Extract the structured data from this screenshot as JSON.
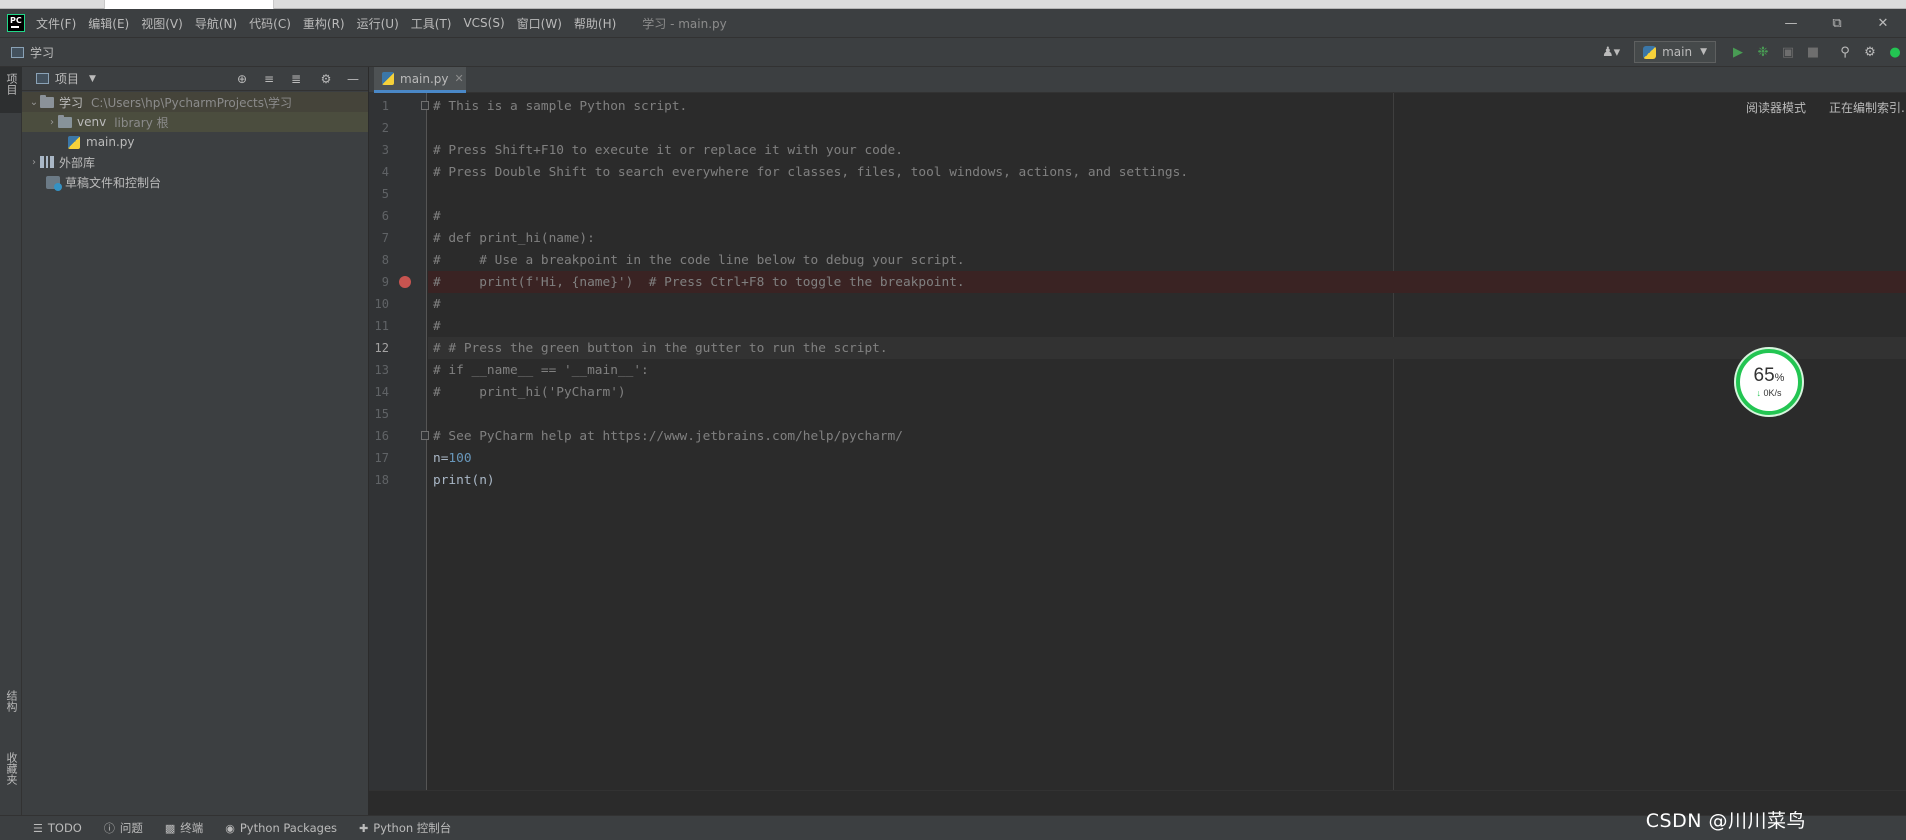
{
  "menubar": {
    "items": [
      "文件(F)",
      "编辑(E)",
      "视图(V)",
      "导航(N)",
      "代码(C)",
      "重构(R)",
      "运行(U)",
      "工具(T)",
      "VCS(S)",
      "窗口(W)",
      "帮助(H)"
    ],
    "window_title": "学习 - main.py",
    "logo_text": "PC"
  },
  "navbar": {
    "breadcrumb": "学习",
    "run_config": "main"
  },
  "left_strip": {
    "project_tab": "项目",
    "structure_tab": "结构",
    "favorites_tab": "收藏夹"
  },
  "project_panel": {
    "title": "项目",
    "tree": [
      {
        "label": "学习",
        "sub": "C:\\Users\\hp\\PycharmProjects\\学习"
      },
      {
        "label": "venv",
        "sub": "library 根"
      },
      {
        "label": "main.py",
        "sub": ""
      },
      {
        "label": "外部库",
        "sub": ""
      },
      {
        "label": "草稿文件和控制台",
        "sub": ""
      }
    ]
  },
  "editor": {
    "tab_label": "main.py",
    "reader_mode": "阅读器模式",
    "indexing": "正在编制索引...",
    "current_line": 12,
    "breakpoint_line": 9,
    "lines": [
      {
        "n": "1",
        "t": "# This is a sample Python script."
      },
      {
        "n": "2",
        "t": ""
      },
      {
        "n": "3",
        "t": "# Press Shift+F10 to execute it or replace it with your code."
      },
      {
        "n": "4",
        "t": "# Press Double Shift to search everywhere for classes, files, tool windows, actions, and settings."
      },
      {
        "n": "5",
        "t": ""
      },
      {
        "n": "6",
        "t": "#"
      },
      {
        "n": "7",
        "t": "# def print_hi(name):"
      },
      {
        "n": "8",
        "t": "#     # Use a breakpoint in the code line below to debug your script."
      },
      {
        "n": "9",
        "t": "#     print(f'Hi, {name}')  # Press Ctrl+F8 to toggle the breakpoint."
      },
      {
        "n": "10",
        "t": "#"
      },
      {
        "n": "11",
        "t": "#"
      },
      {
        "n": "12",
        "t": "# # Press the green button in the gutter to run the script."
      },
      {
        "n": "13",
        "t": "# if __name__ == '__main__':"
      },
      {
        "n": "14",
        "t": "#     print_hi('PyCharm')"
      },
      {
        "n": "15",
        "t": ""
      },
      {
        "n": "16",
        "t": "# See PyCharm help at https://www.jetbrains.com/help/pycharm/"
      },
      {
        "n": "17",
        "t": "n=",
        "num": "100"
      },
      {
        "n": "18",
        "t": "print(n)"
      }
    ]
  },
  "speed_widget": {
    "percent": "65",
    "percent_sign": "%",
    "rate": "0K/s"
  },
  "bottom_bar": {
    "items": [
      "TODO",
      "问题",
      "终端",
      "Python Packages",
      "Python 控制台"
    ]
  },
  "watermark": "CSDN @川川菜鸟",
  "colors": {
    "background": "#2b2b2b",
    "panel": "#3c3f41",
    "comment": "#808080",
    "number": "#6897bb",
    "breakpoint": "#c75450",
    "run_green": "#499c54"
  }
}
